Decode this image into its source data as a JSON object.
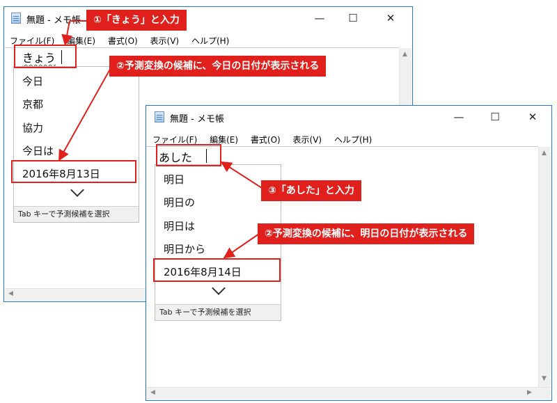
{
  "window1": {
    "title": "無題 - メモ帳",
    "controls": {
      "minimize": "—",
      "maximize": "☐",
      "close": "✕"
    },
    "menu": [
      "ファイル(F)",
      "編集(E)",
      "書式(O)",
      "表示(V)",
      "ヘルプ(H)"
    ],
    "typed_text": "きょう",
    "candidates": [
      "今日",
      "京都",
      "協力",
      "今日は",
      "2016年8月13日"
    ],
    "footer": "Tab キーで予測候補を選択"
  },
  "window2": {
    "title": "無題 - メモ帳",
    "controls": {
      "minimize": "—",
      "maximize": "☐",
      "close": "✕"
    },
    "menu": [
      "ファイル(F)",
      "編集(E)",
      "書式(O)",
      "表示(V)",
      "ヘルプ(H)"
    ],
    "typed_text": "あした",
    "candidates": [
      "明日",
      "明日の",
      "明日は",
      "明日から",
      "2016年8月14日"
    ],
    "footer": "Tab キーで予測候補を選択"
  },
  "callouts": {
    "c1": "①「きょう」と入力",
    "c2": "②予測変換の候補に、今日の日付が表示される",
    "c3": "③「あした」と入力",
    "c4": "②予測変換の候補に、明日の日付が表示される"
  },
  "colors": {
    "accent": "#e0201c",
    "window_border": "#1e7ad6"
  }
}
